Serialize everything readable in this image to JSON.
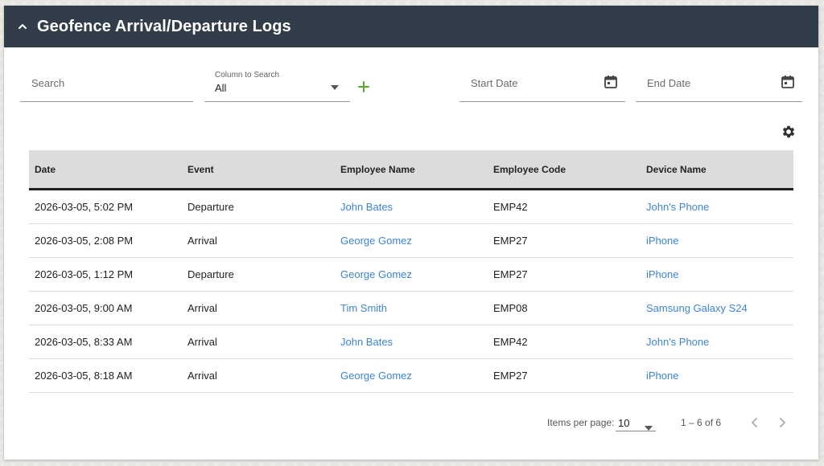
{
  "panel": {
    "title": "Geofence Arrival/Departure Logs"
  },
  "filters": {
    "search_placeholder": "Search",
    "column_label": "Column to Search",
    "column_value": "All",
    "start_placeholder": "Start Date",
    "end_placeholder": "End Date"
  },
  "table": {
    "headers": [
      "Date",
      "Event",
      "Employee Name",
      "Employee Code",
      "Device Name"
    ],
    "rows": [
      [
        "2026-03-05, 5:02 PM",
        "Departure",
        "John Bates",
        "EMP42",
        "John's Phone"
      ],
      [
        "2026-03-05, 2:08 PM",
        "Arrival",
        "George Gomez",
        "EMP27",
        "iPhone"
      ],
      [
        "2026-03-05, 1:12 PM",
        "Departure",
        "George Gomez",
        "EMP27",
        "iPhone"
      ],
      [
        "2026-03-05, 9:00 AM",
        "Arrival",
        "Tim Smith",
        "EMP08",
        "Samsung Galaxy S24"
      ],
      [
        "2026-03-05, 8:33 AM",
        "Arrival",
        "John Bates",
        "EMP42",
        "John's Phone"
      ],
      [
        "2026-03-05, 8:18 AM",
        "Arrival",
        "George Gomez",
        "EMP27",
        "iPhone"
      ]
    ]
  },
  "paginator": {
    "items_per_page_label": "Items per page:",
    "items_per_page": "10",
    "range": "1 – 6 of 6"
  },
  "colors": {
    "header_bg": "#323d4a",
    "link": "#3d84d6",
    "plus": "#5aa832"
  },
  "icons": [
    "chevron-up-icon",
    "caret-down-icon",
    "plus-icon",
    "calendar-icon",
    "gear-icon",
    "chevron-left-icon",
    "chevron-right-icon"
  ]
}
